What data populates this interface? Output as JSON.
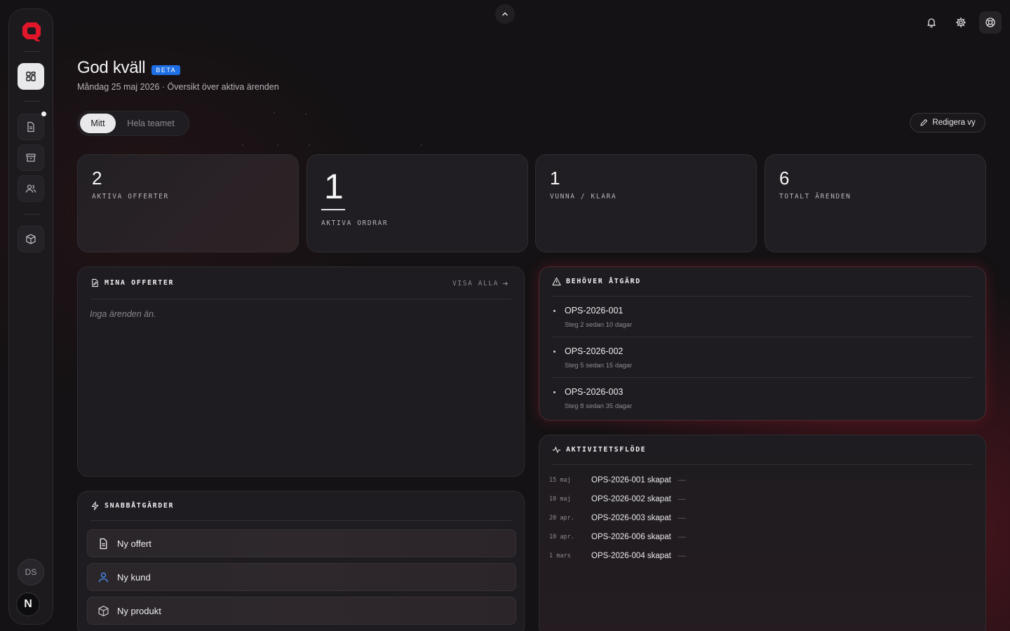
{
  "header": {
    "greeting": "God kväll",
    "badge": "BETA",
    "subtitle": "Måndag 25 maj 2026 · Översikt över aktiva ärenden"
  },
  "scope_toggle": {
    "selected": "Mitt",
    "other": "Hela teamet"
  },
  "edit_view_label": "Redigera vy",
  "stats": [
    {
      "value": "2",
      "label": "AKTIVA OFFERTER"
    },
    {
      "value": "1",
      "label": "AKTIVA ORDRAR"
    },
    {
      "value": "1",
      "label": "VUNNA / KLARA"
    },
    {
      "value": "6",
      "label": "TOTALT ÄRENDEN"
    }
  ],
  "my_offers": {
    "title": "MINA OFFERTER",
    "view_all": "VISA ALLA",
    "empty": "Inga ärenden än."
  },
  "needs_action": {
    "title": "BEHÖVER ÅTGÄRD",
    "items": [
      {
        "id": "OPS-2026-001",
        "detail": "Steg 2 sedan 10 dagar"
      },
      {
        "id": "OPS-2026-002",
        "detail": "Steg 5 sedan 15 dagar"
      },
      {
        "id": "OPS-2026-003",
        "detail": "Steg 8 sedan 35 dagar"
      }
    ]
  },
  "activity": {
    "title": "AKTIVITETSFLÖDE",
    "rows": [
      {
        "date": "15 maj",
        "event": "OPS-2026-001 skapat",
        "meta": "—"
      },
      {
        "date": "10 maj",
        "event": "OPS-2026-002 skapat",
        "meta": "—"
      },
      {
        "date": "20 apr.",
        "event": "OPS-2026-003 skapat",
        "meta": "—"
      },
      {
        "date": "10 apr.",
        "event": "OPS-2026-006 skapat",
        "meta": "—"
      },
      {
        "date": "1 mars",
        "event": "OPS-2026-004 skapat",
        "meta": "—"
      }
    ]
  },
  "quick_actions": {
    "title": "SNABBÅTGÄRDER",
    "items": [
      {
        "label": "Ny offert",
        "icon": "document-icon"
      },
      {
        "label": "Ny kund",
        "icon": "user-icon"
      },
      {
        "label": "Ny produkt",
        "icon": "box-icon"
      }
    ]
  },
  "user": {
    "initials": "DS",
    "secondary_avatar": "N"
  },
  "colors": {
    "brand": "#e2162b",
    "accent_badge": "#1e6fe6",
    "user_icon": "#4a8cf0"
  }
}
